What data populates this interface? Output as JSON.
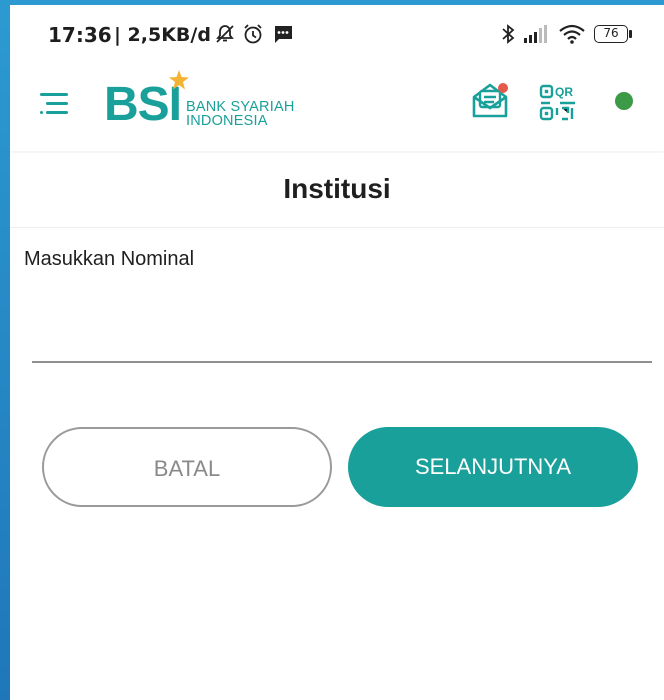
{
  "status_bar": {
    "time": "17:36",
    "speed": "| 2,5KB/d",
    "battery": "76"
  },
  "header": {
    "logo_text": "BSI",
    "logo_line1": "BANK SYARIAH",
    "logo_line2": "INDONESIA",
    "brand_color": "#1aa09a",
    "status_dot_color": "#3c9a46"
  },
  "page": {
    "title": "Institusi"
  },
  "form": {
    "amount_label": "Masukkan Nominal",
    "amount_value": "",
    "amount_placeholder": ""
  },
  "buttons": {
    "cancel": "BATAL",
    "next": "SELANJUTNYA"
  }
}
